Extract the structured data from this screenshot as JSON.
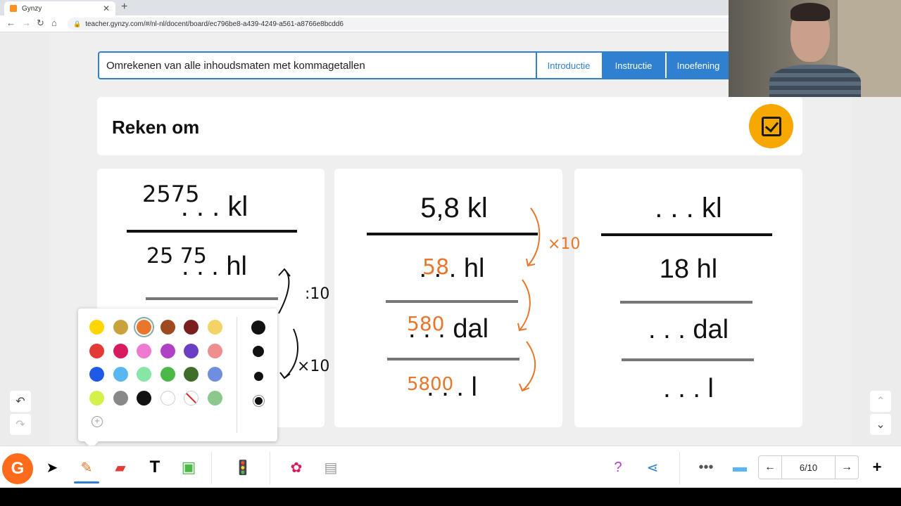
{
  "browser": {
    "tab_title": "Gynzy",
    "url": "teacher.gynzy.com/#/nl-nl/docent/board/ec796be8-a439-4249-a561-a8766e8bcdd6"
  },
  "lesson": {
    "title": "Omrekenen van alle inhoudsmaten met kommagetallen",
    "tabs": [
      "Introductie",
      "Instructie",
      "Inoefening"
    ]
  },
  "header": {
    "title": "Reken om"
  },
  "cards": [
    {
      "top": ". . . kl",
      "mid": ". . . hl"
    },
    {
      "top": "5,8 kl",
      "mid": ". . . hl",
      "low": ". . . dal",
      "bottom": ". . . l"
    },
    {
      "top": ". . . kl",
      "mid": "18 hl",
      "low": ". . . dal",
      "bottom": ". . . l"
    }
  ],
  "ink": {
    "card1_top": "2575",
    "card1_mid": "25 75",
    "div10": ":10",
    "times10_a": "×10",
    "card2_hl": "58",
    "card2_dal": "580",
    "card2_l": "5800",
    "times10_b": "×10",
    "ink_color": "#e8762c"
  },
  "palette": {
    "colors": [
      [
        "#ffd600",
        "#c9a23a",
        "#e8762c",
        "#9c4a1e",
        "#7a1e1e",
        "#f2d466"
      ],
      [
        "#e53935",
        "#d81b60",
        "#ee7ad2",
        "#b041c6",
        "#6a3fc4",
        "#ee8e8e"
      ],
      [
        "#1e5ae6",
        "#58b7f2",
        "#86e6a6",
        "#4cb848",
        "#3f6e2a",
        "#6f8ee0"
      ],
      [
        "#d4f04a",
        "#888888",
        "#111111",
        "#ffffff",
        "none",
        "#8cc88c"
      ]
    ],
    "selected": "#e8762c"
  },
  "pager": {
    "label": "6/10"
  }
}
